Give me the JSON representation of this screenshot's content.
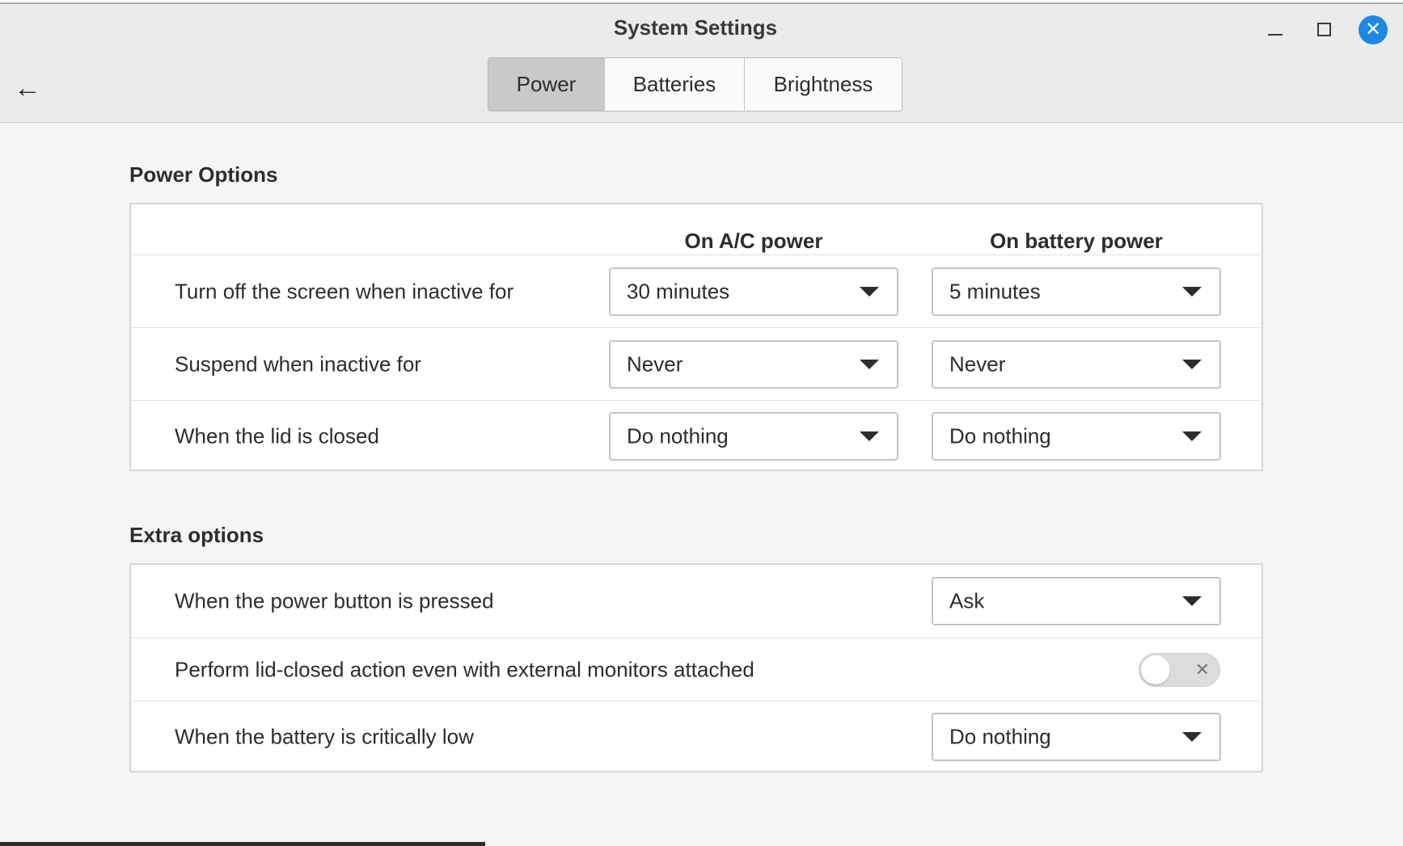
{
  "window": {
    "title": "System Settings",
    "minimize_icon": "minimize-icon",
    "maximize_icon": "maximize-icon",
    "close_icon": "close-icon",
    "close_glyph": "✕",
    "back_icon": "arrow-left-icon",
    "back_glyph": "←"
  },
  "tabs": [
    {
      "label": "Power",
      "active": true
    },
    {
      "label": "Batteries",
      "active": false
    },
    {
      "label": "Brightness",
      "active": false
    }
  ],
  "power_options": {
    "title": "Power Options",
    "columns": [
      "On A/C power",
      "On battery power"
    ],
    "rows": [
      {
        "label": "Turn off the screen when inactive for",
        "ac": "30 minutes",
        "battery": "5 minutes"
      },
      {
        "label": "Suspend when inactive for",
        "ac": "Never",
        "battery": "Never"
      },
      {
        "label": "When the lid is closed",
        "ac": "Do nothing",
        "battery": "Do nothing"
      }
    ]
  },
  "extra_options": {
    "title": "Extra options",
    "rows": [
      {
        "label": "When the power button is pressed",
        "value": "Ask"
      },
      {
        "label": "Perform lid-closed action even with external monitors attached",
        "toggle_on": false,
        "toggle_glyph": "✕"
      },
      {
        "label": "When the battery is critically low",
        "value": "Do nothing"
      }
    ]
  },
  "colors": {
    "accent": "#1e88e5",
    "header_bg": "#ebebeb",
    "active_tab_bg": "#c9c9c9",
    "window_bg": "#f5f5f5"
  }
}
